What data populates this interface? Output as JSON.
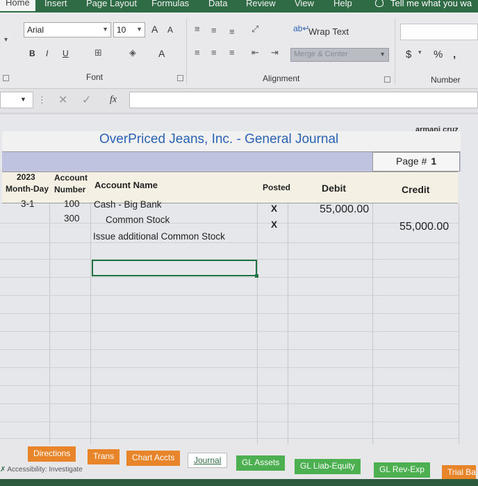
{
  "ribbon_tabs": [
    "Home",
    "Insert",
    "Page Layout",
    "Formulas",
    "Data",
    "Review",
    "View",
    "Help"
  ],
  "tell_me": "Tell me what you wa",
  "font": {
    "name": "Arial",
    "size": "10",
    "grow": "A",
    "shrink": "A",
    "bold": "B",
    "italic": "I",
    "underline": "U",
    "font_color": "A",
    "group_label": "Font"
  },
  "alignment": {
    "wrap_text": "Wrap Text",
    "merge_center": "Merge & Center",
    "group_label": "Alignment"
  },
  "number": {
    "currency": "$",
    "percent": "%",
    "comma": ",",
    "group_label": "Number"
  },
  "formula_bar": {
    "fx": "fx",
    "value": ""
  },
  "sheet": {
    "owner": "armani cruz",
    "title": "OverPriced Jeans, Inc.  -  General Journal",
    "page_label": "Page #",
    "page_number": "1",
    "headers": {
      "year": "2023",
      "month_day": "Month-Day",
      "account_top": "Account",
      "account_bottom": "Number",
      "account_name": "Account Name",
      "posted": "Posted",
      "debit": "Debit",
      "credit": "Credit"
    },
    "entries": [
      {
        "date": "3-1",
        "account": "100",
        "name": "Cash - Big Bank",
        "posted": "X",
        "debit": "55,000.00",
        "credit": ""
      },
      {
        "date": "",
        "account": "300",
        "name": "Common Stock",
        "posted": "X",
        "debit": "",
        "credit": "55,000.00"
      },
      {
        "date": "",
        "account": "",
        "name": "Issue additional Common Stock",
        "posted": "",
        "debit": "",
        "credit": ""
      }
    ]
  },
  "sheet_tabs": [
    {
      "label": "Directions",
      "color": "#e8842a"
    },
    {
      "label": "Trans",
      "color": "#e8842a"
    },
    {
      "label": "Chart Accts",
      "color": "#e8842a"
    },
    {
      "label": "Journal",
      "color": "#ffffff"
    },
    {
      "label": "GL Assets",
      "color": "#4caf50"
    },
    {
      "label": "GL Liab-Equity",
      "color": "#4caf50"
    },
    {
      "label": "GL Rev-Exp",
      "color": "#4caf50"
    },
    {
      "label": "Trial Ba",
      "color": "#e8842a"
    }
  ],
  "status": "Accessibility: Investigate"
}
